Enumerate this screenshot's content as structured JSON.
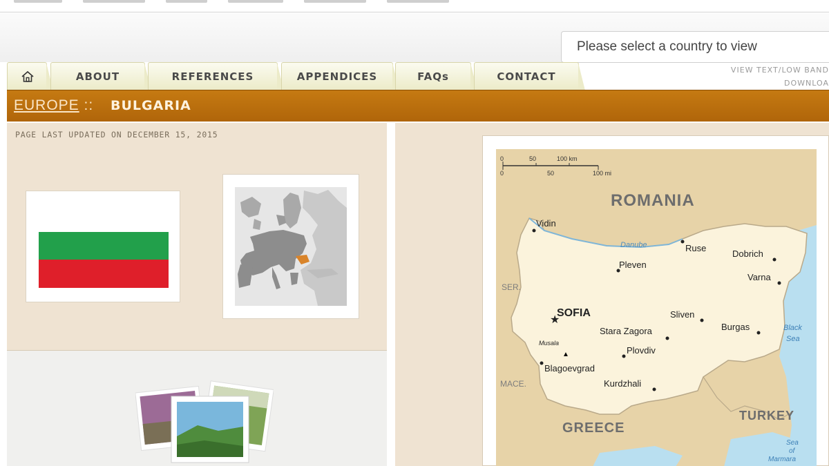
{
  "header": {
    "country_select_placeholder": "Please select a country to view"
  },
  "tabs": [
    {
      "label": "ABOUT"
    },
    {
      "label": "REFERENCES"
    },
    {
      "label": "APPENDICES"
    },
    {
      "label": "FAQs"
    },
    {
      "label": "CONTACT"
    }
  ],
  "links": {
    "view_text_line1": "VIEW TEXT/LOW BAND",
    "view_text_line2": "DOWNLOA"
  },
  "breadcrumb": {
    "region": "EUROPE",
    "separator": "::",
    "country": "BULGARIA"
  },
  "page": {
    "updated": "PAGE LAST UPDATED ON DECEMBER 15, 2015"
  },
  "map": {
    "scale_km": [
      "0",
      "50",
      "100 km"
    ],
    "scale_mi": [
      "0",
      "50",
      "100 mi"
    ],
    "countries": [
      "ROMANIA",
      "SER.",
      "MACE.",
      "GREECE",
      "TURKEY"
    ],
    "capital": "SOFIA",
    "cities": [
      "Vidin",
      "Ruse",
      "Dobrich",
      "Pleven",
      "Varna",
      "Sliven",
      "Stara Zagora",
      "Burgas",
      "Plovdiv",
      "Blagoevgrad",
      "Kurdzhali"
    ],
    "peak": "Musala",
    "river": "Danube",
    "seas": [
      "Black",
      "Sea",
      "Sea",
      "of",
      "Marmara"
    ]
  },
  "colors": {
    "region_bar": "#b86d0c",
    "panel": "#efe3d2",
    "flag_white": "#ffffff",
    "flag_green": "#22a04b",
    "flag_red": "#df1f2a"
  }
}
